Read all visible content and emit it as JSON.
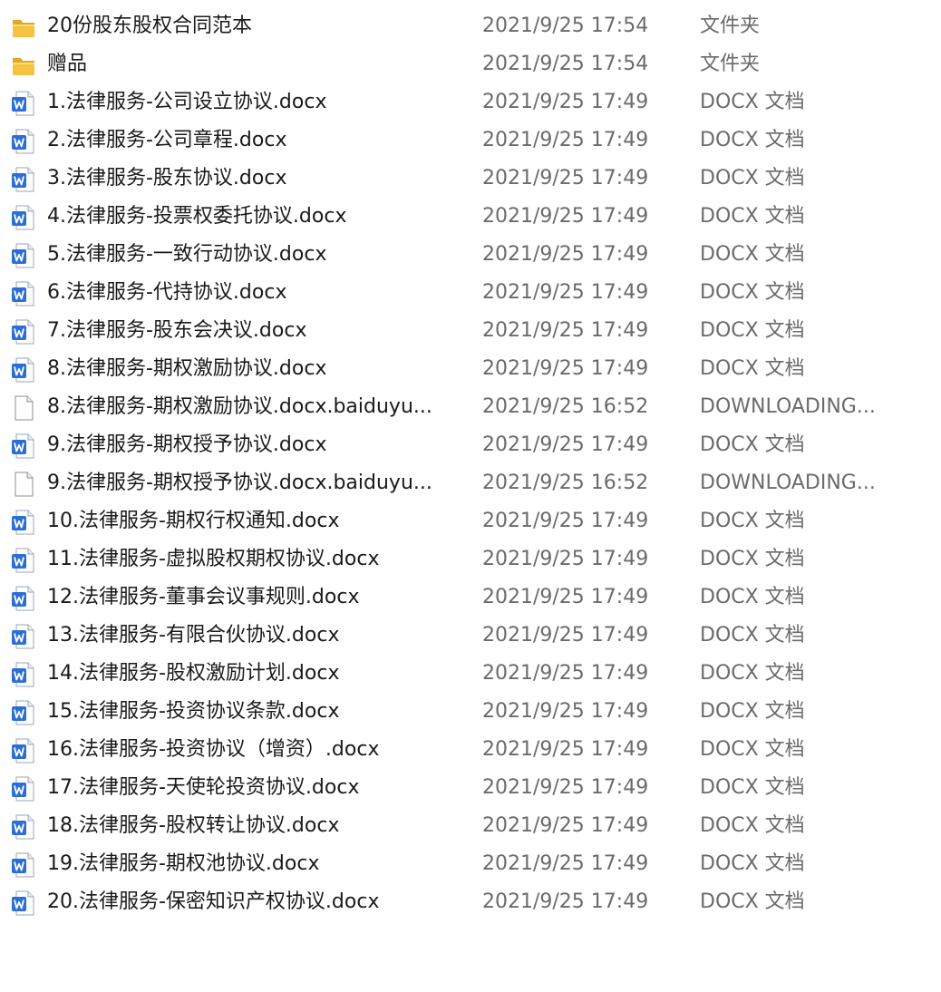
{
  "files": [
    {
      "name": "20份股东股权合同范本",
      "date": "2021/9/25 17:54",
      "type": "文件夹",
      "icon": "folder-icon"
    },
    {
      "name": "赠品",
      "date": "2021/9/25 17:54",
      "type": "文件夹",
      "icon": "folder-icon"
    },
    {
      "name": "1.法律服务-公司设立协议.docx",
      "date": "2021/9/25 17:49",
      "type": "DOCX 文档",
      "icon": "docx-icon"
    },
    {
      "name": "2.法律服务-公司章程.docx",
      "date": "2021/9/25 17:49",
      "type": "DOCX 文档",
      "icon": "docx-icon"
    },
    {
      "name": "3.法律服务-股东协议.docx",
      "date": "2021/9/25 17:49",
      "type": "DOCX 文档",
      "icon": "docx-icon"
    },
    {
      "name": "4.法律服务-投票权委托协议.docx",
      "date": "2021/9/25 17:49",
      "type": "DOCX 文档",
      "icon": "docx-icon"
    },
    {
      "name": "5.法律服务-一致行动协议.docx",
      "date": "2021/9/25 17:49",
      "type": "DOCX 文档",
      "icon": "docx-icon"
    },
    {
      "name": "6.法律服务-代持协议.docx",
      "date": "2021/9/25 17:49",
      "type": "DOCX 文档",
      "icon": "docx-icon"
    },
    {
      "name": "7.法律服务-股东会决议.docx",
      "date": "2021/9/25 17:49",
      "type": "DOCX 文档",
      "icon": "docx-icon"
    },
    {
      "name": "8.法律服务-期权激励协议.docx",
      "date": "2021/9/25 17:49",
      "type": "DOCX 文档",
      "icon": "docx-icon"
    },
    {
      "name": "8.法律服务-期权激励协议.docx.baiduyu...",
      "date": "2021/9/25 16:52",
      "type": "DOWNLOADING...",
      "icon": "blank-file-icon"
    },
    {
      "name": "9.法律服务-期权授予协议.docx",
      "date": "2021/9/25 17:49",
      "type": "DOCX 文档",
      "icon": "docx-icon"
    },
    {
      "name": "9.法律服务-期权授予协议.docx.baiduyu...",
      "date": "2021/9/25 16:52",
      "type": "DOWNLOADING...",
      "icon": "blank-file-icon"
    },
    {
      "name": "10.法律服务-期权行权通知.docx",
      "date": "2021/9/25 17:49",
      "type": "DOCX 文档",
      "icon": "docx-icon"
    },
    {
      "name": "11.法律服务-虚拟股权期权协议.docx",
      "date": "2021/9/25 17:49",
      "type": "DOCX 文档",
      "icon": "docx-icon"
    },
    {
      "name": "12.法律服务-董事会议事规则.docx",
      "date": "2021/9/25 17:49",
      "type": "DOCX 文档",
      "icon": "docx-icon"
    },
    {
      "name": "13.法律服务-有限合伙协议.docx",
      "date": "2021/9/25 17:49",
      "type": "DOCX 文档",
      "icon": "docx-icon"
    },
    {
      "name": "14.法律服务-股权激励计划.docx",
      "date": "2021/9/25 17:49",
      "type": "DOCX 文档",
      "icon": "docx-icon"
    },
    {
      "name": "15.法律服务-投资协议条款.docx",
      "date": "2021/9/25 17:49",
      "type": "DOCX 文档",
      "icon": "docx-icon"
    },
    {
      "name": "16.法律服务-投资协议（增资）.docx",
      "date": "2021/9/25 17:49",
      "type": "DOCX 文档",
      "icon": "docx-icon"
    },
    {
      "name": "17.法律服务-天使轮投资协议.docx",
      "date": "2021/9/25 17:49",
      "type": "DOCX 文档",
      "icon": "docx-icon"
    },
    {
      "name": "18.法律服务-股权转让协议.docx",
      "date": "2021/9/25 17:49",
      "type": "DOCX 文档",
      "icon": "docx-icon"
    },
    {
      "name": "19.法律服务-期权池协议.docx",
      "date": "2021/9/25 17:49",
      "type": "DOCX 文档",
      "icon": "docx-icon"
    },
    {
      "name": "20.法律服务-保密知识产权协议.docx",
      "date": "2021/9/25 17:49",
      "type": "DOCX 文档",
      "icon": "docx-icon"
    }
  ],
  "colors": {
    "folder": "#f5c342",
    "folder_dark": "#e0a82a",
    "docx_blue": "#2b6fd6",
    "name_text": "#1a1a1a",
    "meta_text": "#6b6b6b"
  }
}
